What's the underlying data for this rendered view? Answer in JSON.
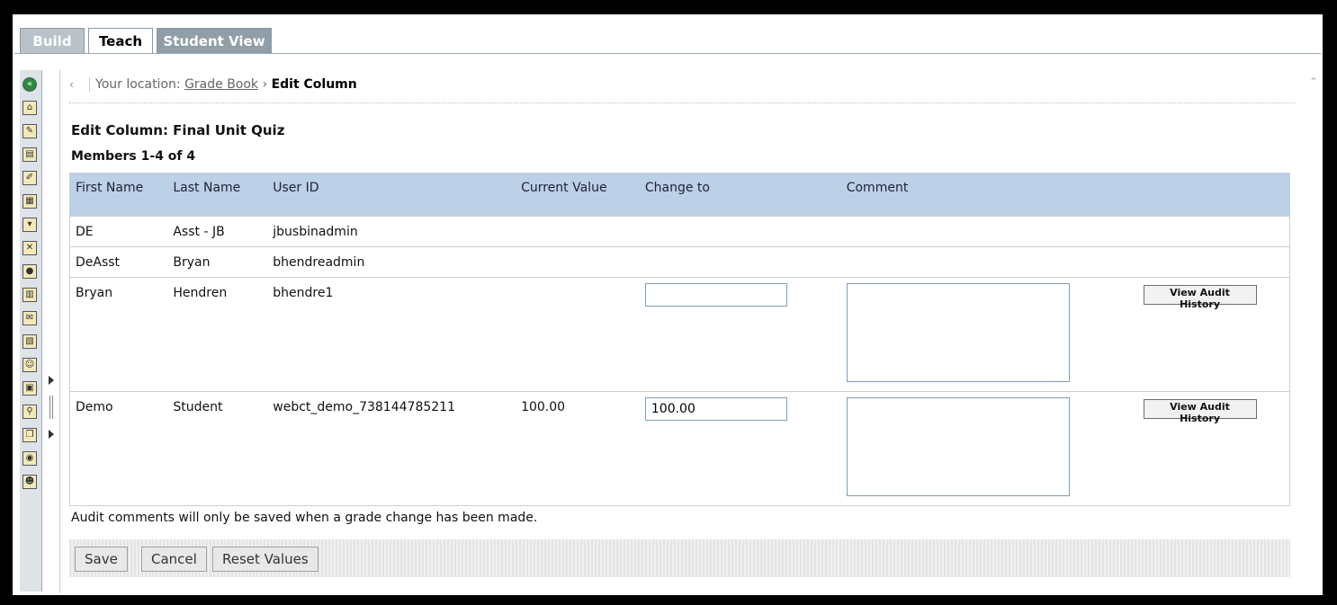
{
  "tabs": [
    "Build",
    "Teach",
    "Student View"
  ],
  "breadcrumb": {
    "back": "‹",
    "prefix": "Your location:",
    "link": "Grade Book",
    "arrow": "›",
    "current": "Edit Column"
  },
  "page_title": "Edit Column: Final Unit Quiz",
  "members": "Members 1-4 of 4",
  "table": {
    "headers": [
      "First Name",
      "Last Name",
      "User ID",
      "Current Value",
      "Change to",
      "Comment"
    ],
    "rows": [
      {
        "first": "DE",
        "last": "Asst - JB",
        "user_id": "jbusbinadmin",
        "current": "",
        "editable": false
      },
      {
        "first": "DeAsst",
        "last": "Bryan",
        "user_id": "bhendreadmin",
        "current": "",
        "editable": false
      },
      {
        "first": "Bryan",
        "last": "Hendren",
        "user_id": "bhendre1",
        "current": "",
        "editable": true,
        "change_to": "",
        "audit_button": "View Audit History"
      },
      {
        "first": "Demo",
        "last": "Student",
        "user_id": "webct_demo_738144785211",
        "current": "100.00",
        "editable": true,
        "change_to": "100.00",
        "audit_button": "View Audit History"
      }
    ]
  },
  "note": "Audit comments will only be saved when a grade change has been made.",
  "buttons": {
    "save": "Save",
    "cancel": "Cancel",
    "reset": "Reset Values"
  },
  "colors": {
    "header_bg": "#bcd0e8",
    "frame": "#000000"
  }
}
